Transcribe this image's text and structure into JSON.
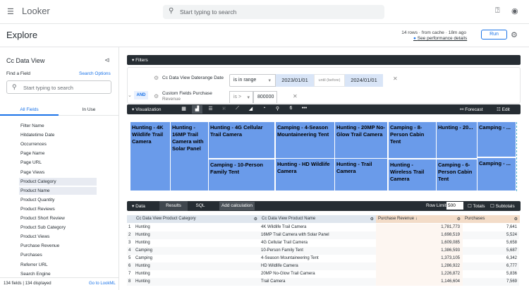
{
  "app": {
    "logo": "Looker",
    "search_placeholder": "Start typing to search"
  },
  "header": {
    "title": "Explore",
    "status": "14 rows · from cache · 18m ago",
    "perf_link": "See performance details",
    "run": "Run"
  },
  "sidebar": {
    "title": "Cc Data View",
    "find_label": "Find a Field",
    "search_options": "Search Options",
    "search_placeholder": "Start typing to search",
    "tabs": [
      "All Fields",
      "In Use"
    ],
    "fields": [
      "Filter Name",
      "Hitdatetime Date",
      "Occurrences",
      "Page Name",
      "Page URL",
      "Page Views",
      "Product Category",
      "Product Name",
      "Product Quantity",
      "Product Reviews",
      "Product Short Review",
      "Product Sub Category",
      "Product Views",
      "Purchase Revenue",
      "Purchases",
      "Referrer URL",
      "Search Engine"
    ],
    "footer_count": "134 fields | 134 displayed",
    "lookml_link": "Go to LookML"
  },
  "filters": {
    "label": "Filters",
    "and": "AND",
    "f1": {
      "field": "Cc Data View Daterange Date",
      "op": "is in range",
      "from": "2023/01/01",
      "until": "until (before)",
      "to": "2024/01/01"
    },
    "f2": {
      "field": "Custom Fields Purchase",
      "field2": "Revenue",
      "op": "is >",
      "value": "800000"
    }
  },
  "viz": {
    "label": "Visualization",
    "forecast": "Forecast",
    "edit": "Edit",
    "tiles": [
      "Hunting - 4K Wildlife Trail Camera",
      "Hunting - 16MP Trail Camera with Solar Panel",
      "Hunting - 4G Cellular Trail Camera",
      "Camping - 10-Person Family Tent",
      "Camping - 4-Season Mountaineering Tent",
      "Hunting - HD Wildlife Camera",
      "Hunting - 20MP No-Glow Trail Camera",
      "Hunting - Trail Camera",
      "Camping - 8-Person Cabin Tent",
      "Hunting - Wireless Trail Camera",
      "Hunting - 20...",
      "Camping - 6-Person Cabin Tent",
      "Camping - ...",
      "Camping - ..."
    ],
    "tile_color": "#6a9bea"
  },
  "data": {
    "label": "Data",
    "tabs": [
      "Results",
      "SQL"
    ],
    "add_calc": "Add calculation",
    "row_limit_label": "Row Limit",
    "row_limit": "500",
    "totals": "Totals",
    "subtotals": "Subtotals",
    "columns": [
      "Cc Data View Product Category",
      "Cc Data View Product Name",
      "Purchase Revenue ↓",
      "Purchases"
    ],
    "rows": [
      [
        "1",
        "Hunting",
        "4K Wildlife Trail Camera",
        "1,781,773",
        "7,641"
      ],
      [
        "2",
        "Hunting",
        "16MP Trail Camera with Solar Panel",
        "1,698,519",
        "5,524"
      ],
      [
        "3",
        "Hunting",
        "4G Cellular Trail Camera",
        "1,609,085",
        "5,658"
      ],
      [
        "4",
        "Camping",
        "10-Person Family Tent",
        "1,386,593",
        "5,687"
      ],
      [
        "5",
        "Camping",
        "4-Season Mountaineering Tent",
        "1,373,105",
        "6,342"
      ],
      [
        "6",
        "Hunting",
        "HD Wildlife Camera",
        "1,286,922",
        "6,777"
      ],
      [
        "7",
        "Hunting",
        "20MP No-Glow Trail Camera",
        "1,226,872",
        "5,836"
      ],
      [
        "8",
        "Hunting",
        "Trail Camera",
        "1,146,604",
        "7,569"
      ]
    ]
  }
}
